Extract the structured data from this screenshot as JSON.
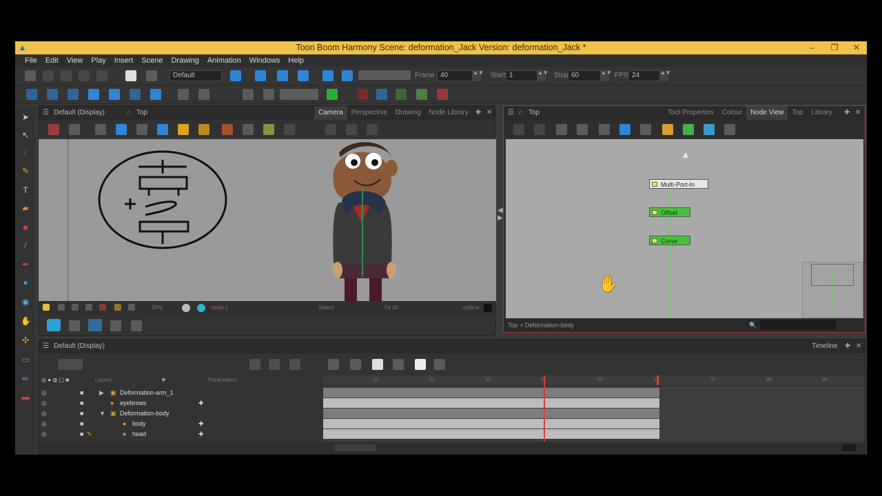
{
  "window": {
    "title": "Toon Boom Harmony Scene: deformation_Jack Version: deformation_Jack *",
    "buttons": [
      "–",
      "❐",
      "✕"
    ]
  },
  "menu": [
    "File",
    "Edit",
    "View",
    "Play",
    "Insert",
    "Scene",
    "Drawing",
    "Animation",
    "Windows",
    "Help"
  ],
  "playback": {
    "preset": "Default",
    "frame_label": "Frame",
    "frame_value": "40",
    "start_label": "Start",
    "start_value": "1",
    "stop_label": "Stop",
    "stop_value": "60",
    "fps_label": "FPS",
    "fps_value": "24"
  },
  "camera_panel": {
    "view_name": "Default (Display)",
    "breadcrumb": "Top",
    "tabs": [
      "Camera",
      "Perspective",
      "Drawing",
      "Node Library"
    ],
    "active_tab": "Camera",
    "status_drawing": "head-1",
    "status_select": "Select",
    "status_fit": "Fit 40",
    "zoom": "30%",
    "status_outline": "outline"
  },
  "node_panel": {
    "breadcrumb": "Top",
    "tabs": [
      "Tool Properties",
      "Colour",
      "Node View",
      "Top",
      "Library"
    ],
    "active_tab": "Node View",
    "nodes": [
      {
        "label": "Multi-Port-In",
        "color": "#e8e8e8"
      },
      {
        "label": "Offset",
        "color": "#46c23c"
      },
      {
        "label": "Curve",
        "color": "#46c23c"
      }
    ],
    "path": "Top > Deformation-body"
  },
  "timeline_panel": {
    "view_name": "Default (Display)",
    "title": "Timeline",
    "col_layers": "Layers",
    "col_params": "Parameters",
    "layers": [
      {
        "name": "Deformation-arm_1",
        "indent": 1,
        "expanded": false
      },
      {
        "name": "eyebrows",
        "indent": 1
      },
      {
        "name": "Deformation-body",
        "indent": 1,
        "expanded": true
      },
      {
        "name": "body",
        "indent": 2
      },
      {
        "name": "head",
        "indent": 2
      }
    ],
    "ruler": [
      "10",
      "20",
      "30",
      "40",
      "50",
      "60",
      "70",
      "80",
      "90"
    ],
    "current_frame": 40,
    "stop_frame": 60
  }
}
